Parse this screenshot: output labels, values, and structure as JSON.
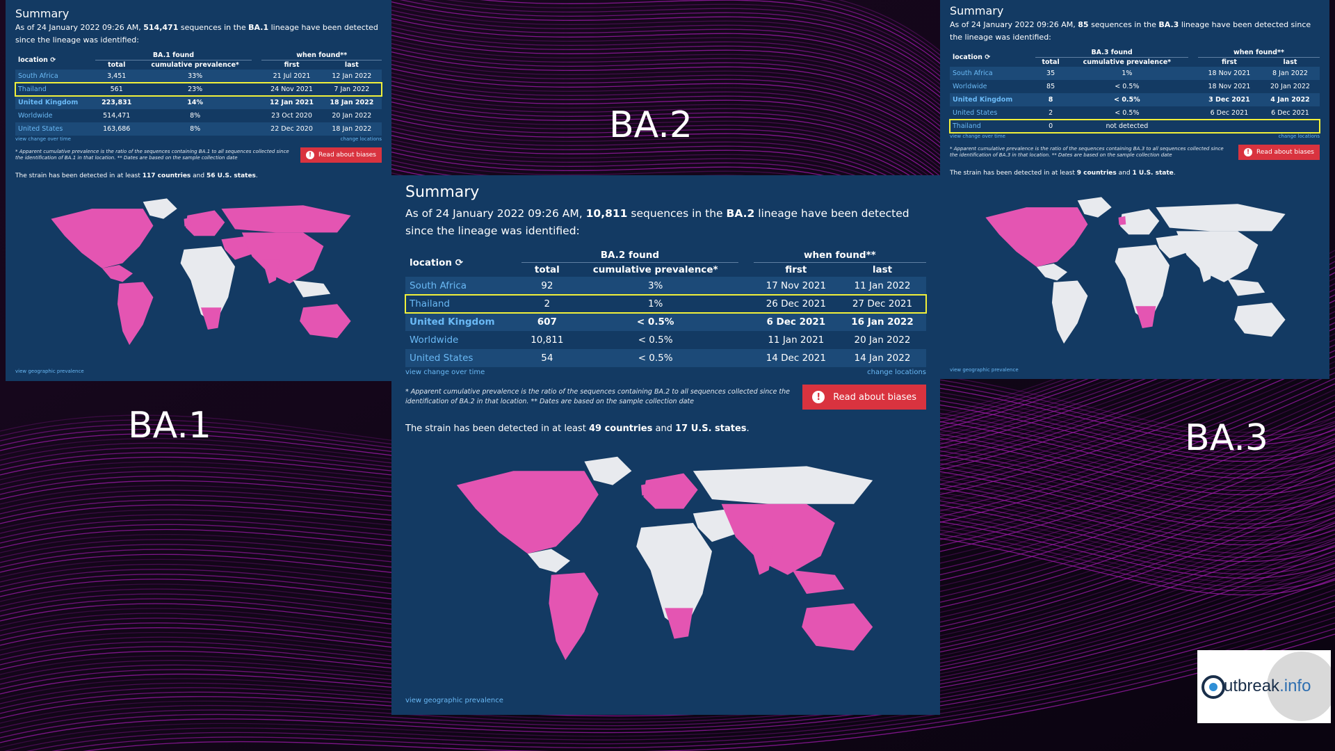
{
  "labels": {
    "ba1": "BA.1",
    "ba2": "BA.2",
    "ba3": "BA.3"
  },
  "logo": {
    "name": "utbreak",
    "domain": ".info"
  },
  "colors": {
    "panel_bg": "#133a63",
    "highlight_row_border": "#f1f03a",
    "detected_country": "#e455b2",
    "link": "#6ab9f5",
    "button": "#d9333f"
  },
  "ba1": {
    "title": "Summary",
    "desc": {
      "prefix": "As of 24 January 2022 09:26 AM,",
      "count": "514,471",
      "mid": "sequences in the",
      "lineage": "BA.1",
      "suffix": "lineage have been detected since the lineage was identified:"
    },
    "table": {
      "location_label": "location",
      "found_group": "BA.1 found",
      "when_group": "when found**",
      "col_total": "total",
      "col_prev": "cumulative prevalence*",
      "col_first": "first",
      "col_last": "last",
      "rows": [
        {
          "loc": "South Africa",
          "total": "3,451",
          "prev": "33%",
          "first": "21 Jul 2021",
          "last": "12 Jan 2022"
        },
        {
          "loc": "Thailand",
          "total": "561",
          "prev": "23%",
          "first": "24 Nov 2021",
          "last": "7 Jan 2022"
        },
        {
          "loc": "United Kingdom",
          "total": "223,831",
          "prev": "14%",
          "first": "12 Jan 2021",
          "last": "18 Jan 2022"
        },
        {
          "loc": "Worldwide",
          "total": "514,471",
          "prev": "8%",
          "first": "23 Oct 2020",
          "last": "20 Jan 2022"
        },
        {
          "loc": "United States",
          "total": "163,686",
          "prev": "8%",
          "first": "22 Dec 2020",
          "last": "18 Jan 2022"
        }
      ]
    },
    "view_change": "view change over time",
    "change_locations": "change locations",
    "note": "* Apparent cumulative prevalence is the ratio of the sequences containing BA.1 to all sequences collected since the identification of BA.1 in that location. ** Dates are based on the sample collection date",
    "bias_button": "Read about biases",
    "strain": {
      "prefix": "The strain has been detected in at least",
      "countries": "117 countries",
      "and": "and",
      "states": "56 U.S. states"
    },
    "geo_link": "view geographic prevalence"
  },
  "ba2": {
    "title": "Summary",
    "desc": {
      "prefix": "As of 24 January 2022 09:26 AM,",
      "count": "10,811",
      "mid": "sequences in the",
      "lineage": "BA.2",
      "suffix": "lineage have been detected since the lineage was identified:"
    },
    "table": {
      "location_label": "location",
      "found_group": "BA.2 found",
      "when_group": "when found**",
      "col_total": "total",
      "col_prev": "cumulative prevalence*",
      "col_first": "first",
      "col_last": "last",
      "rows": [
        {
          "loc": "South Africa",
          "total": "92",
          "prev": "3%",
          "first": "17 Nov 2021",
          "last": "11 Jan 2022"
        },
        {
          "loc": "Thailand",
          "total": "2",
          "prev": "1%",
          "first": "26 Dec 2021",
          "last": "27 Dec 2021"
        },
        {
          "loc": "United Kingdom",
          "total": "607",
          "prev": "< 0.5%",
          "first": "6 Dec 2021",
          "last": "16 Jan 2022"
        },
        {
          "loc": "Worldwide",
          "total": "10,811",
          "prev": "< 0.5%",
          "first": "11 Jan 2021",
          "last": "20 Jan 2022"
        },
        {
          "loc": "United States",
          "total": "54",
          "prev": "< 0.5%",
          "first": "14 Dec 2021",
          "last": "14 Jan 2022"
        }
      ]
    },
    "view_change": "view change over time",
    "change_locations": "change locations",
    "note": "* Apparent cumulative prevalence is the ratio of the sequences containing BA.2 to all sequences collected since the identification of BA.2 in that location. ** Dates are based on the sample collection date",
    "bias_button": "Read about biases",
    "strain": {
      "prefix": "The strain has been detected in at least",
      "countries": "49 countries",
      "and": "and",
      "states": "17 U.S. states"
    },
    "geo_link": "view geographic prevalence"
  },
  "ba3": {
    "title": "Summary",
    "desc": {
      "prefix": "As of 24 January 2022 09:26 AM,",
      "count": "85",
      "mid": "sequences in the",
      "lineage": "BA.3",
      "suffix": "lineage have been detected since the lineage was identified:"
    },
    "table": {
      "location_label": "location",
      "found_group": "BA.3 found",
      "when_group": "when found**",
      "col_total": "total",
      "col_prev": "cumulative prevalence*",
      "col_first": "first",
      "col_last": "last",
      "rows": [
        {
          "loc": "South Africa",
          "total": "35",
          "prev": "1%",
          "first": "18 Nov 2021",
          "last": "8 Jan 2022"
        },
        {
          "loc": "Worldwide",
          "total": "85",
          "prev": "< 0.5%",
          "first": "18 Nov 2021",
          "last": "20 Jan 2022"
        },
        {
          "loc": "United Kingdom",
          "total": "8",
          "prev": "< 0.5%",
          "first": "3 Dec 2021",
          "last": "4 Jan 2022"
        },
        {
          "loc": "United States",
          "total": "2",
          "prev": "< 0.5%",
          "first": "6 Dec 2021",
          "last": "6 Dec 2021"
        }
      ],
      "not_detected_row": {
        "loc": "Thailand",
        "total": "0",
        "status": "not detected"
      }
    },
    "view_change": "view change over time",
    "change_locations": "change locations",
    "note": "* Apparent cumulative prevalence is the ratio of the sequences containing BA.3 to all sequences collected since the identification of BA.3 in that location. ** Dates are based on the sample collection date",
    "bias_button": "Read about biases",
    "strain": {
      "prefix": "The strain has been detected in at least",
      "countries": "9 countries",
      "and": "and",
      "states": "1 U.S. state"
    },
    "geo_link": "view geographic prevalence"
  }
}
